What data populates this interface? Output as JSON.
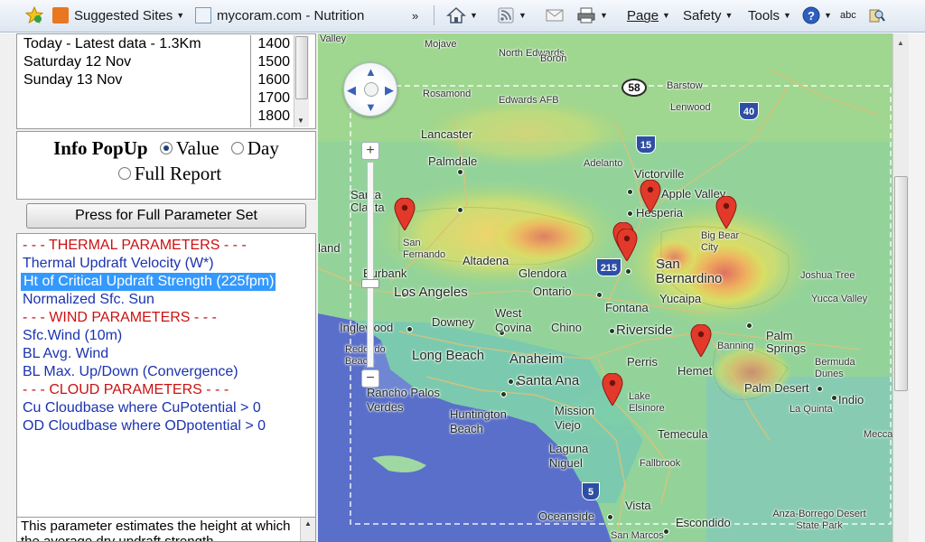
{
  "toolbar": {
    "suggested_sites": "Suggested Sites",
    "tab_title": "mycoram.com - Nutrition",
    "overflow": "»",
    "menus": [
      "Page",
      "Safety",
      "Tools"
    ],
    "spell": "abc"
  },
  "dates": [
    "Today - Latest data - 1.3Km",
    "Saturday 12 Nov",
    "Sunday 13 Nov"
  ],
  "times": [
    "1400",
    "1500",
    "1600",
    "1700",
    "1800"
  ],
  "popup": {
    "title": "Info PopUp",
    "options": [
      "Value",
      "Day",
      "Full Report"
    ],
    "selected": "Value"
  },
  "full_param_button": "Press for Full Parameter Set",
  "parameters": [
    {
      "text": "- - - THERMAL PARAMETERS - - -",
      "kind": "header"
    },
    {
      "text": "Thermal Updraft Velocity (W*)",
      "kind": "link"
    },
    {
      "text": "Ht of Critical Updraft Strength (225fpm)",
      "kind": "selected"
    },
    {
      "text": "Normalized Sfc. Sun",
      "kind": "link"
    },
    {
      "text": "- - - WIND PARAMETERS - - -",
      "kind": "header"
    },
    {
      "text": "Sfc.Wind (10m)",
      "kind": "link"
    },
    {
      "text": "BL Avg. Wind",
      "kind": "link"
    },
    {
      "text": "BL Max. Up/Down (Convergence)",
      "kind": "link"
    },
    {
      "text": "- - - CLOUD PARAMETERS - - -",
      "kind": "header"
    },
    {
      "text": "Cu Cloudbase where CuPotential > 0",
      "kind": "link"
    },
    {
      "text": "OD Cloudbase where ODpotential > 0",
      "kind": "link"
    }
  ],
  "description": "This parameter estimates the height at which the average dry updraft strength",
  "map": {
    "shields": [
      "58",
      "15",
      "40",
      "215",
      "5"
    ],
    "labels": [
      {
        "t": "Mojave",
        "s": "sm"
      },
      {
        "t": "North Edwards",
        "s": "sm"
      },
      {
        "t": "Boron",
        "s": "sm"
      },
      {
        "t": "Rosamond",
        "s": "sm"
      },
      {
        "t": "Edwards AFB",
        "s": "sm"
      },
      {
        "t": "Barstow",
        "s": "sm"
      },
      {
        "t": "Lenwood",
        "s": "sm"
      },
      {
        "t": "Lancaster",
        "s": "med"
      },
      {
        "t": "Palmdale",
        "s": "med"
      },
      {
        "t": "Adelanto",
        "s": "sm"
      },
      {
        "t": "Victorville",
        "s": "med"
      },
      {
        "t": "Apple Valley",
        "s": "med"
      },
      {
        "t": "Hesperia",
        "s": "med"
      },
      {
        "t": "Santa Clarita",
        "s": "med"
      },
      {
        "t": "San Fernando",
        "s": "sm"
      },
      {
        "t": "Big Bear City",
        "s": "sm"
      },
      {
        "t": "Altadena",
        "s": "med"
      },
      {
        "t": "Glendora",
        "s": "med"
      },
      {
        "t": "San Bernardino",
        "s": "big"
      },
      {
        "t": "Joshua Tree",
        "s": "sm"
      },
      {
        "t": "Burbank",
        "s": "med"
      },
      {
        "t": "Los Angeles",
        "s": "big"
      },
      {
        "t": "Ontario",
        "s": "med"
      },
      {
        "t": "Yucaipa",
        "s": "med"
      },
      {
        "t": "Yucca Valley",
        "s": "sm"
      },
      {
        "t": "Downey",
        "s": "med"
      },
      {
        "t": "Fontana",
        "s": "med"
      },
      {
        "t": "Inglewood",
        "s": "med"
      },
      {
        "t": "West Covina",
        "s": "med"
      },
      {
        "t": "Chino",
        "s": "med"
      },
      {
        "t": "Riverside",
        "s": "big"
      },
      {
        "t": "Palm Springs",
        "s": "med"
      },
      {
        "t": "Redondo Beach",
        "s": "sm"
      },
      {
        "t": "Long Beach",
        "s": "big"
      },
      {
        "t": "Anaheim",
        "s": "big"
      },
      {
        "t": "Banning",
        "s": "sm"
      },
      {
        "t": "Perris",
        "s": "med"
      },
      {
        "t": "Hemet",
        "s": "med"
      },
      {
        "t": "Bermuda Dunes",
        "s": "sm"
      },
      {
        "t": "Santa Ana",
        "s": "big"
      },
      {
        "t": "Palm Desert",
        "s": "med"
      },
      {
        "t": "Indio",
        "s": "med"
      },
      {
        "t": "Rancho Palos Verdes",
        "s": "med"
      },
      {
        "t": "Huntington Beach",
        "s": "med"
      },
      {
        "t": "Mission Viejo",
        "s": "med"
      },
      {
        "t": "Lake Elsinore",
        "s": "sm"
      },
      {
        "t": "La Quinta",
        "s": "sm"
      },
      {
        "t": "Temecula",
        "s": "med"
      },
      {
        "t": "Laguna Niguel",
        "s": "med"
      },
      {
        "t": "Mecca",
        "s": "sm"
      },
      {
        "t": "Fallbrook",
        "s": "sm"
      },
      {
        "t": "Oceanside",
        "s": "med"
      },
      {
        "t": "Vista",
        "s": "med"
      },
      {
        "t": "Escondido",
        "s": "med"
      },
      {
        "t": "Anza-Borrego Desert State Park",
        "s": "sm"
      },
      {
        "t": "San Marcos",
        "s": "sm"
      },
      {
        "t": "Valley",
        "s": "sm"
      },
      {
        "t": "land",
        "s": "med"
      }
    ]
  }
}
